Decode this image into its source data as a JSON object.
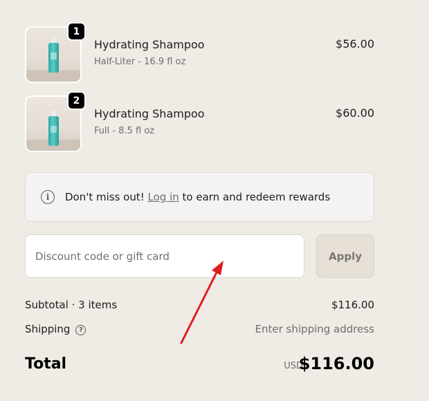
{
  "line_items": [
    {
      "quantity": "1",
      "name": "Hydrating Shampoo",
      "variant": "Half-Liter - 16.9 fl oz",
      "price": "$56.00"
    },
    {
      "quantity": "2",
      "name": "Hydrating Shampoo",
      "variant": "Full - 8.5 fl oz",
      "price": "$60.00"
    }
  ],
  "rewards": {
    "icon": "info-icon",
    "prefix": "Don't miss out! ",
    "link_label": "Log in",
    "suffix": " to earn and redeem rewards"
  },
  "discount": {
    "placeholder": "Discount code or gift card",
    "value": "",
    "apply_label": "Apply"
  },
  "summary": {
    "subtotal_label": "Subtotal · 3 items",
    "subtotal_value": "$116.00",
    "shipping_label": "Shipping",
    "shipping_value": "Enter shipping address",
    "total_label": "Total",
    "currency": "USD",
    "total_value": "$116.00"
  },
  "colors": {
    "page_background": "#efebe5",
    "product_teal": "#3cbab5",
    "annotation_arrow": "#e01b1b"
  }
}
